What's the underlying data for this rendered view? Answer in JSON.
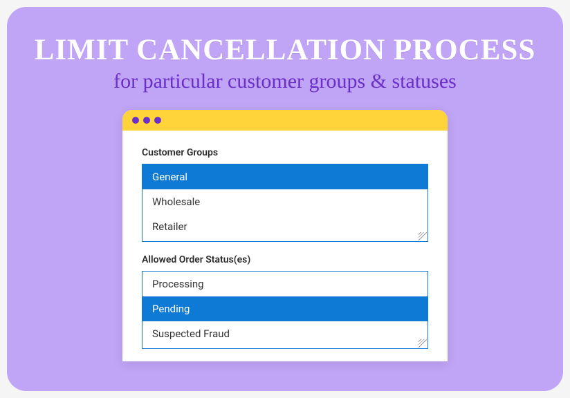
{
  "heading": {
    "title": "LIMIT CANCELLATION PROCESS",
    "subtitle": "for particular customer groups & statuses"
  },
  "colors": {
    "card_bg": "#c0a4f5",
    "accent_yellow": "#ffd43b",
    "dot_purple": "#6b2fc9",
    "select_blue": "#0f79d6"
  },
  "sections": {
    "customer_groups": {
      "label": "Customer Groups",
      "items": [
        "General",
        "Wholesale",
        "Retailer"
      ],
      "selected_index": 0
    },
    "order_statuses": {
      "label": "Allowed Order Status(es)",
      "items": [
        "Processing",
        "Pending",
        "Suspected Fraud"
      ],
      "selected_index": 1
    }
  }
}
